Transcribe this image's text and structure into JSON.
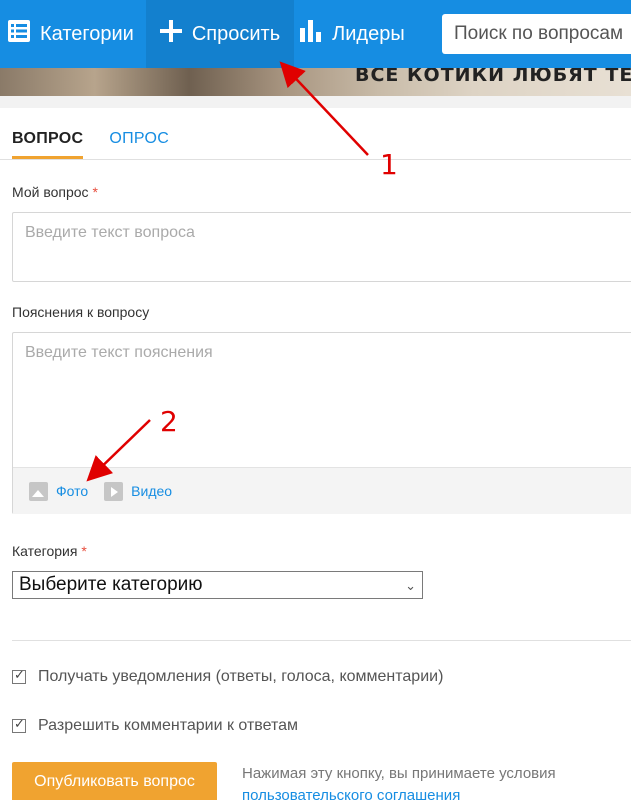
{
  "nav": {
    "categories_label": "Категории",
    "ask_label": "Спросить",
    "leaders_label": "Лидеры",
    "search_placeholder": "Поиск по вопросам",
    "color_bg": "#168de2"
  },
  "banner": {
    "text": "ВСЕ КОТИКИ ЛЮБЯТ  ТЕПЛ"
  },
  "tabs": [
    {
      "label": "ВОПРОС",
      "active": true
    },
    {
      "label": "ОПРОС",
      "active": false
    }
  ],
  "form": {
    "question_label": "Мой вопрос",
    "required_mark": "*",
    "question_placeholder": "Введите текст вопроса",
    "desc_label": "Пояснения к вопросу",
    "desc_placeholder": "Введите текст пояснения",
    "photo_label": "Фото",
    "video_label": "Видео",
    "category_label": "Категория",
    "category_value": "Выберите категорию",
    "notify_label": "Получать уведомления (ответы, голоса, комментарии)",
    "notify_checked": true,
    "allow_comments_label": "Разрешить комментарии к ответам",
    "allow_comments_checked": true,
    "publish_label": "Опубликовать вопрос",
    "terms_text": "Нажимая эту кнопку, вы принимаете условия",
    "terms_link": "пользовательского соглашения",
    "accent_color": "#f0a330"
  },
  "annotations": [
    {
      "number": "1"
    },
    {
      "number": "2"
    }
  ]
}
